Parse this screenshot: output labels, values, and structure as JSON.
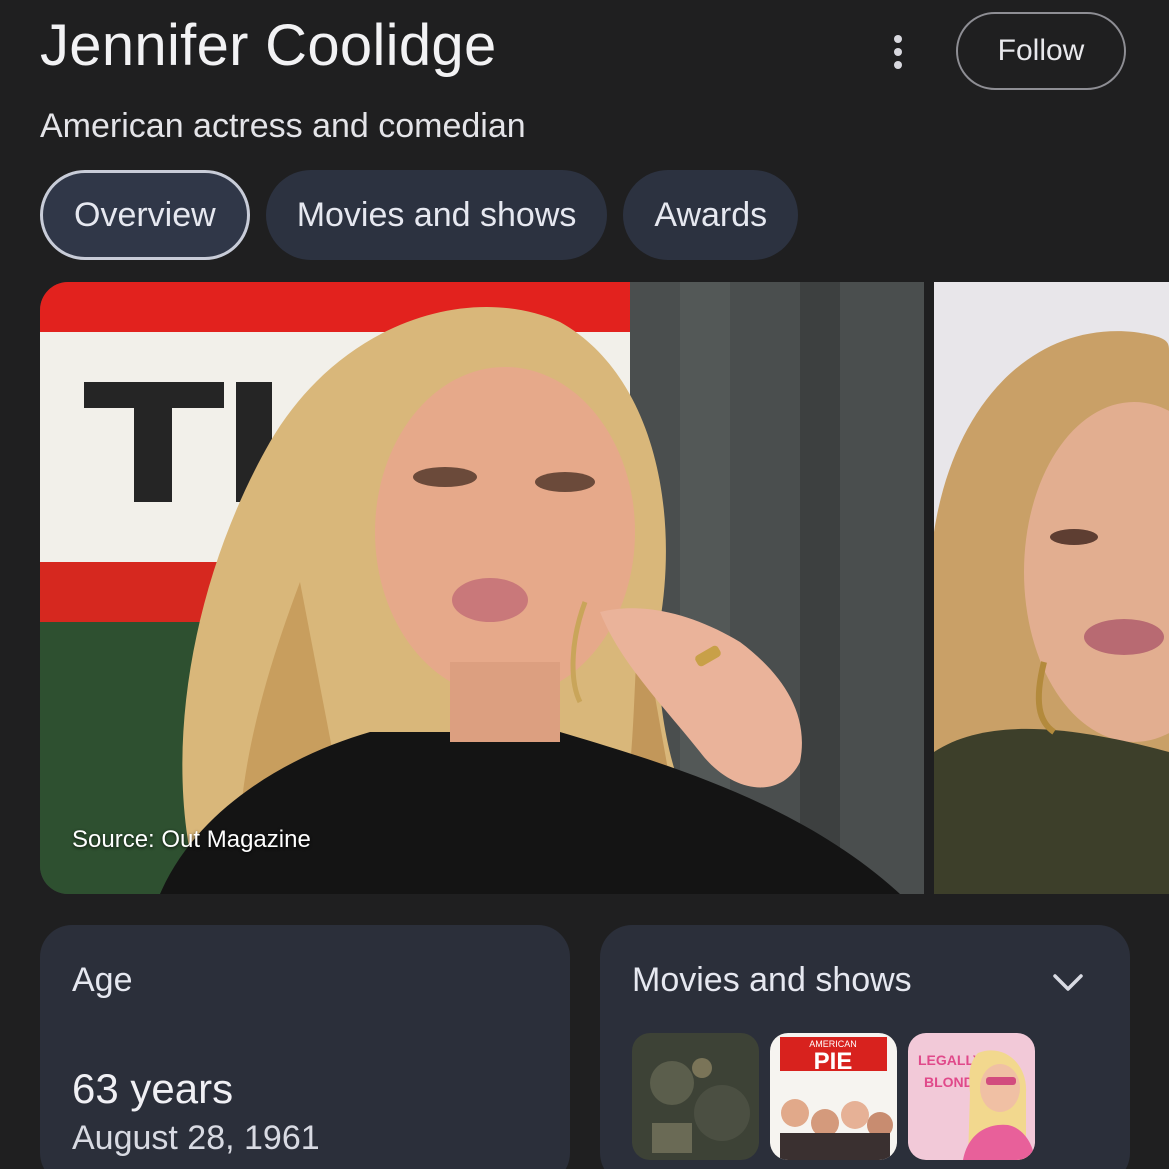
{
  "header": {
    "title": "Jennifer Coolidge",
    "subtitle": "American actress and comedian",
    "follow_label": "Follow"
  },
  "tabs": [
    {
      "label": "Overview",
      "active": true
    },
    {
      "label": "Movies and shows",
      "active": false
    },
    {
      "label": "Awards",
      "active": false
    }
  ],
  "images": {
    "source_caption": "Source: Out Magazine"
  },
  "age_card": {
    "label": "Age",
    "value": "63 years",
    "date": "August 28, 1961"
  },
  "movies_card": {
    "label": "Movies and shows",
    "thumbnails": [
      {
        "alt": "Movie poster 1"
      },
      {
        "alt": "American Pie poster",
        "text": "PIE",
        "top_text": "AMERICAN"
      },
      {
        "alt": "Legally Blonde poster",
        "text_line1": "LEGALLY",
        "text_line2": "BLONDE"
      }
    ]
  },
  "colors": {
    "background": "#1f1f20",
    "tab_bg": "#2c3240",
    "card_bg": "#2b2f3a",
    "accent_border": "#c8ccd8"
  }
}
